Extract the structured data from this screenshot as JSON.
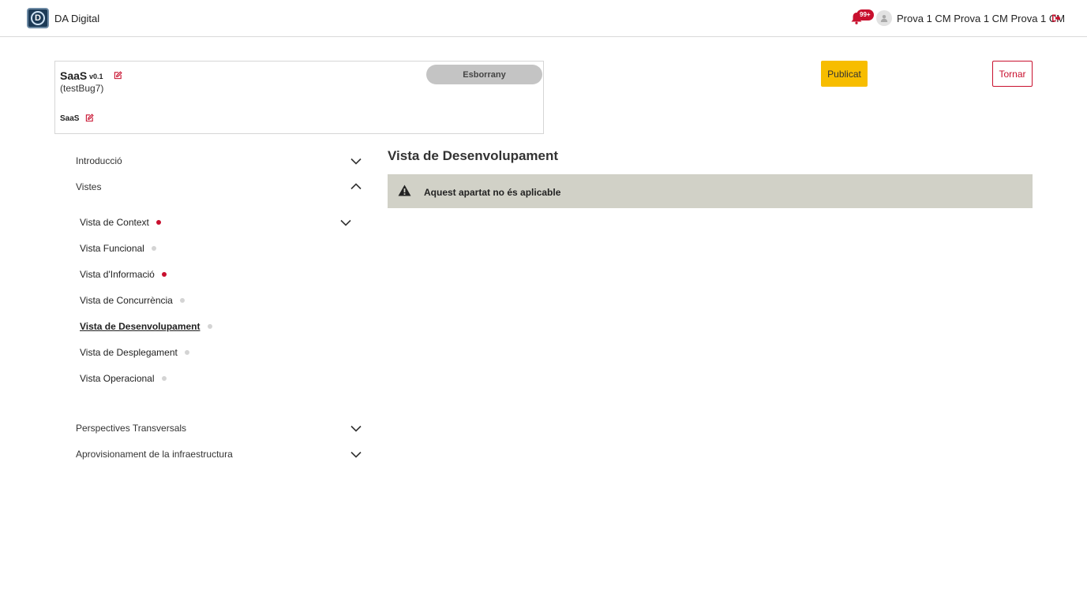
{
  "header": {
    "app_name": "DA Digital",
    "logo_letter": "D",
    "notifications_badge": "99+",
    "user_name": "Prova 1 CM Prova 1 CM Prova 1 CM"
  },
  "document": {
    "title": "SaaS",
    "version": "v0.1",
    "code": "(testBug7)",
    "subtitle": "SaaS",
    "status": "Esborrany"
  },
  "actions": {
    "publish_label": "Publicat",
    "back_label": "Tornar"
  },
  "sidebar": {
    "sections": [
      {
        "label": "Introducció",
        "expanded": false
      },
      {
        "label": "Vistes",
        "expanded": true
      },
      {
        "label": "Perspectives Transversals",
        "expanded": false
      },
      {
        "label": "Aprovisionament de la infraestructura",
        "expanded": false
      }
    ],
    "views": [
      {
        "label": "Vista de Context",
        "status": "red",
        "has_chevron": true
      },
      {
        "label": "Vista Funcional",
        "status": "grey"
      },
      {
        "label": "Vista d'Informació",
        "status": "red"
      },
      {
        "label": "Vista de Concurrència",
        "status": "grey"
      },
      {
        "label": "Vista de Desenvolupament",
        "status": "grey",
        "active": true
      },
      {
        "label": "Vista de Desplegament",
        "status": "grey"
      },
      {
        "label": "Vista Operacional",
        "status": "grey"
      }
    ]
  },
  "main": {
    "title": "Vista de Desenvolupament",
    "notice": "Aquest apartat no és aplicable"
  },
  "colors": {
    "accent_red": "#c8102e",
    "publish_yellow": "#f7bd00",
    "notice_bg": "#d1d1c7",
    "status_grey": "#c4c4c4"
  }
}
